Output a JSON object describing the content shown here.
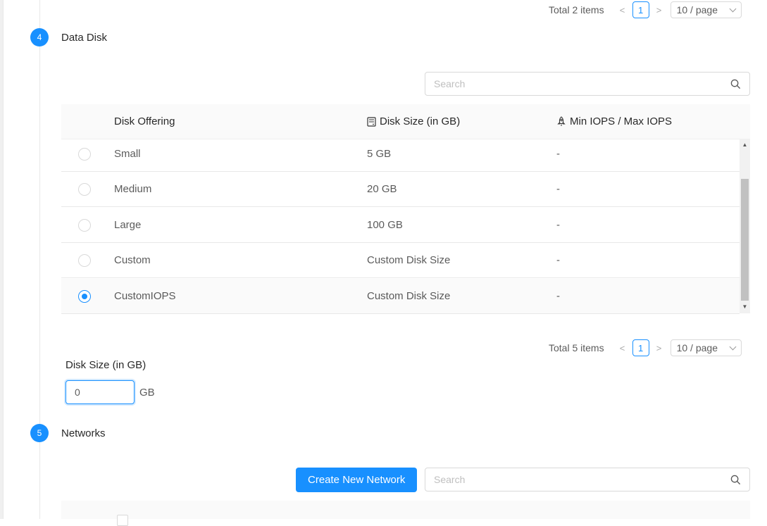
{
  "top_pager": {
    "total": "Total 2 items",
    "prev": "<",
    "page": "1",
    "next": ">",
    "page_size": "10 / page"
  },
  "data_disk": {
    "step_number": "4",
    "title": "Data Disk",
    "search_placeholder": "Search",
    "columns": [
      "Disk Offering",
      "Disk Size (in GB)",
      "Min IOPS / Max IOPS"
    ],
    "rows": [
      {
        "name": "Small",
        "size": "5 GB",
        "iops": "-",
        "selected": false
      },
      {
        "name": "Medium",
        "size": "20 GB",
        "iops": "-",
        "selected": false
      },
      {
        "name": "Large",
        "size": "100 GB",
        "iops": "-",
        "selected": false
      },
      {
        "name": "Custom",
        "size": "Custom Disk Size",
        "iops": "-",
        "selected": false
      },
      {
        "name": "CustomIOPS",
        "size": "Custom Disk Size",
        "iops": "-",
        "selected": true
      }
    ],
    "pager": {
      "total": "Total 5 items",
      "prev": "<",
      "page": "1",
      "next": ">",
      "page_size": "10 / page"
    },
    "disk_size_label": "Disk Size (in GB)",
    "disk_size_value": "0",
    "disk_size_unit": "GB"
  },
  "networks": {
    "step_number": "5",
    "title": "Networks",
    "create_button": "Create New Network",
    "search_placeholder": "Search"
  },
  "colors": {
    "primary": "#1890ff",
    "header_bg": "#fafafa",
    "border": "#e8e8e8"
  },
  "icons": {
    "search": "search-icon",
    "disk": "disk-icon",
    "rocket": "rocket-icon"
  }
}
